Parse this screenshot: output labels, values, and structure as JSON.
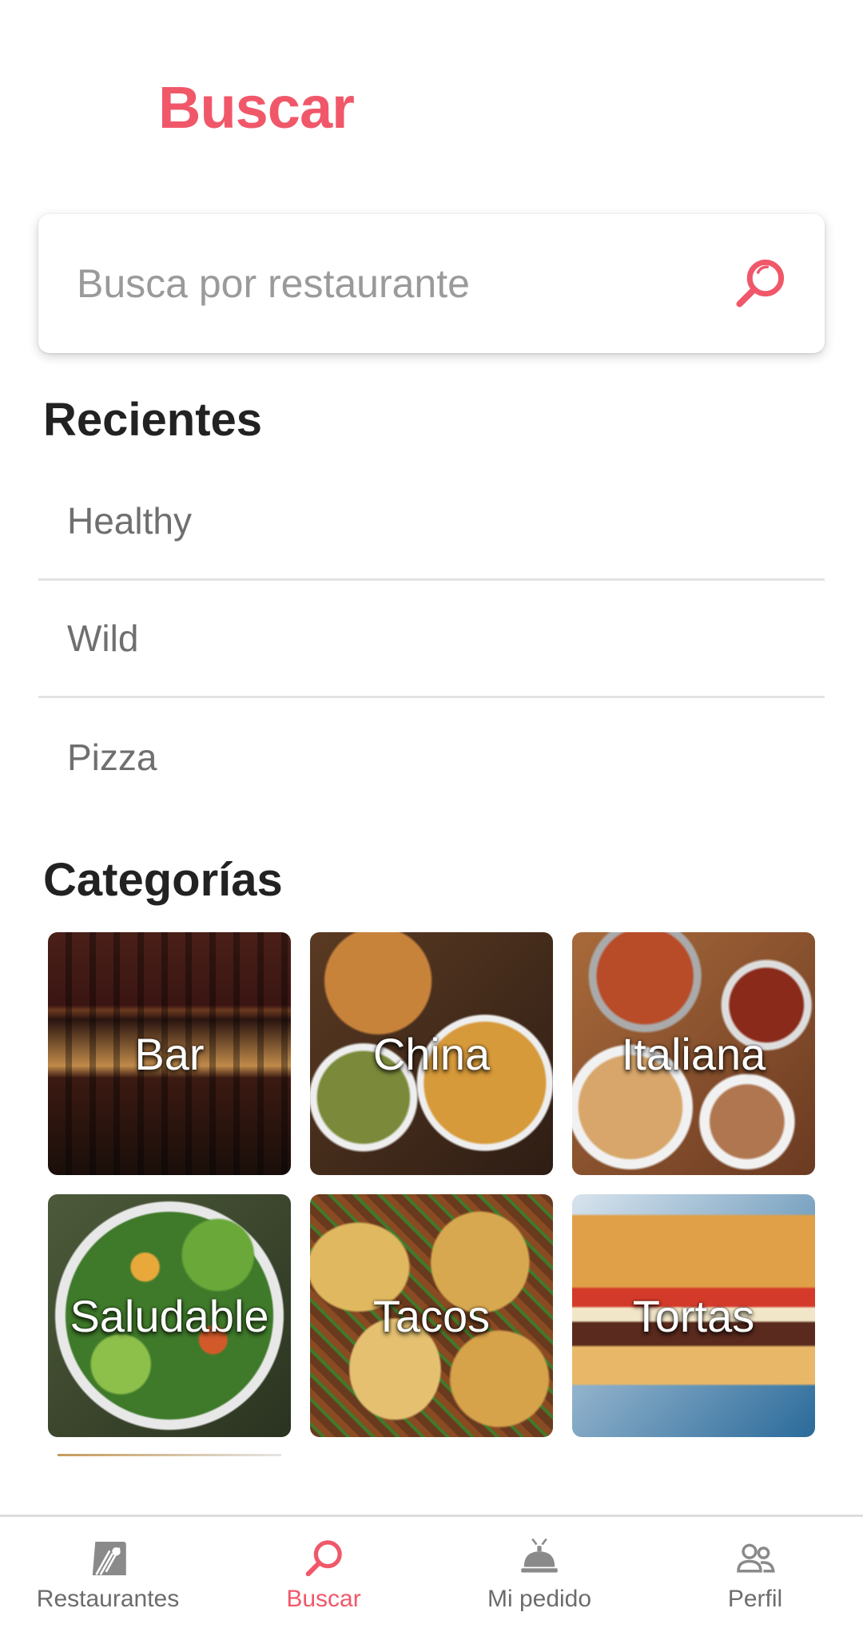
{
  "header": {
    "title": "Buscar"
  },
  "search": {
    "placeholder": "Busca por restaurante",
    "value": ""
  },
  "recents": {
    "heading": "Recientes",
    "items": [
      "Healthy",
      "Wild",
      "Pizza"
    ]
  },
  "categories": {
    "heading": "Categorías",
    "items": [
      "Bar",
      "China",
      "Italiana",
      "Saludable",
      "Tacos",
      "Tortas"
    ]
  },
  "bottom_nav": {
    "items": [
      {
        "label": "Restaurantes",
        "icon": "restaurant-icon",
        "active": false
      },
      {
        "label": "Buscar",
        "icon": "search-icon",
        "active": true
      },
      {
        "label": "Mi pedido",
        "icon": "service-bell-icon",
        "active": false
      },
      {
        "label": "Perfil",
        "icon": "people-icon",
        "active": false
      }
    ]
  },
  "colors": {
    "accent": "#f0586a",
    "text_muted": "#6f6f6f",
    "divider": "#e3e3e3"
  }
}
